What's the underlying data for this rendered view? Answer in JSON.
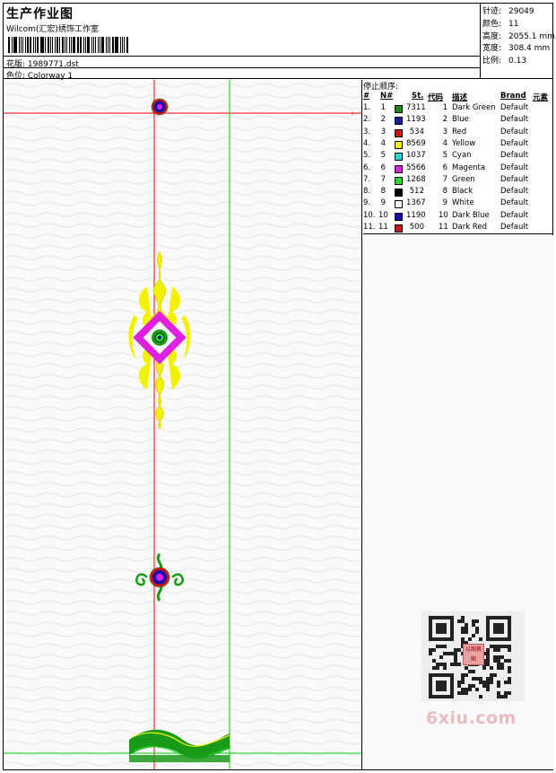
{
  "header": {
    "title": "生产作业图",
    "company": "Wilcom(汇宏)绣饰工作室",
    "file_label": "花版:",
    "file_value": "1989771.dst",
    "colorway_label": "色位:",
    "colorway_value": "Colorway 1"
  },
  "stats": {
    "stitches_label": "针迹:",
    "stitches_value": "29049",
    "colors_label": "颜色:",
    "colors_value": "11",
    "height_label": "高度:",
    "height_value": "2055.1 mm",
    "width_label": "宽度:",
    "width_value": "308.4 mm",
    "scale_label": "比例:",
    "scale_value": "0.13"
  },
  "stop_sequence": {
    "caption": "停止顺序:",
    "headers": [
      "#",
      "N#",
      "St.",
      "代码",
      "描述",
      "Brand",
      "元素"
    ],
    "rows": [
      {
        "index": "1.",
        "n": "1",
        "color": "#1a8a1a",
        "stitches": "7311",
        "code": "1",
        "desc": "Dark Green",
        "brand": "Default"
      },
      {
        "index": "2.",
        "n": "2",
        "color": "#1a1aa8",
        "stitches": "1193",
        "code": "2",
        "desc": "Blue",
        "brand": "Default"
      },
      {
        "index": "3.",
        "n": "3",
        "color": "#d81010",
        "stitches": "534",
        "code": "3",
        "desc": "Red",
        "brand": "Default"
      },
      {
        "index": "4.",
        "n": "4",
        "color": "#f2f200",
        "stitches": "8569",
        "code": "4",
        "desc": "Yellow",
        "brand": "Default"
      },
      {
        "index": "5.",
        "n": "5",
        "color": "#22d8d8",
        "stitches": "1037",
        "code": "5",
        "desc": "Cyan",
        "brand": "Default"
      },
      {
        "index": "6.",
        "n": "6",
        "color": "#e020e0",
        "stitches": "5566",
        "code": "6",
        "desc": "Magenta",
        "brand": "Default"
      },
      {
        "index": "7.",
        "n": "7",
        "color": "#22e022",
        "stitches": "1268",
        "code": "7",
        "desc": "Green",
        "brand": "Default"
      },
      {
        "index": "8.",
        "n": "8",
        "color": "#000000",
        "stitches": "512",
        "code": "8",
        "desc": "Black",
        "brand": "Default"
      },
      {
        "index": "9.",
        "n": "9",
        "color": "#f4f4f4",
        "stitches": "1367",
        "code": "9",
        "desc": "White",
        "brand": "Default"
      },
      {
        "index": "10.",
        "n": "10",
        "color": "#1010b0",
        "stitches": "1190",
        "code": "10",
        "desc": "Dark Blue",
        "brand": "Default"
      },
      {
        "index": "11.",
        "n": "11",
        "color": "#c81818",
        "stitches": "500",
        "code": "11",
        "desc": "Dark Red",
        "brand": "Default"
      }
    ]
  },
  "watermark": {
    "text": "6xiu.com",
    "qr_badge": "以图换图"
  },
  "colors": {
    "guide_red": "#ff0000",
    "guide_green": "#00d000",
    "yellow": "#f2f200",
    "magenta": "#e020e0",
    "green": "#1a9a1a"
  }
}
